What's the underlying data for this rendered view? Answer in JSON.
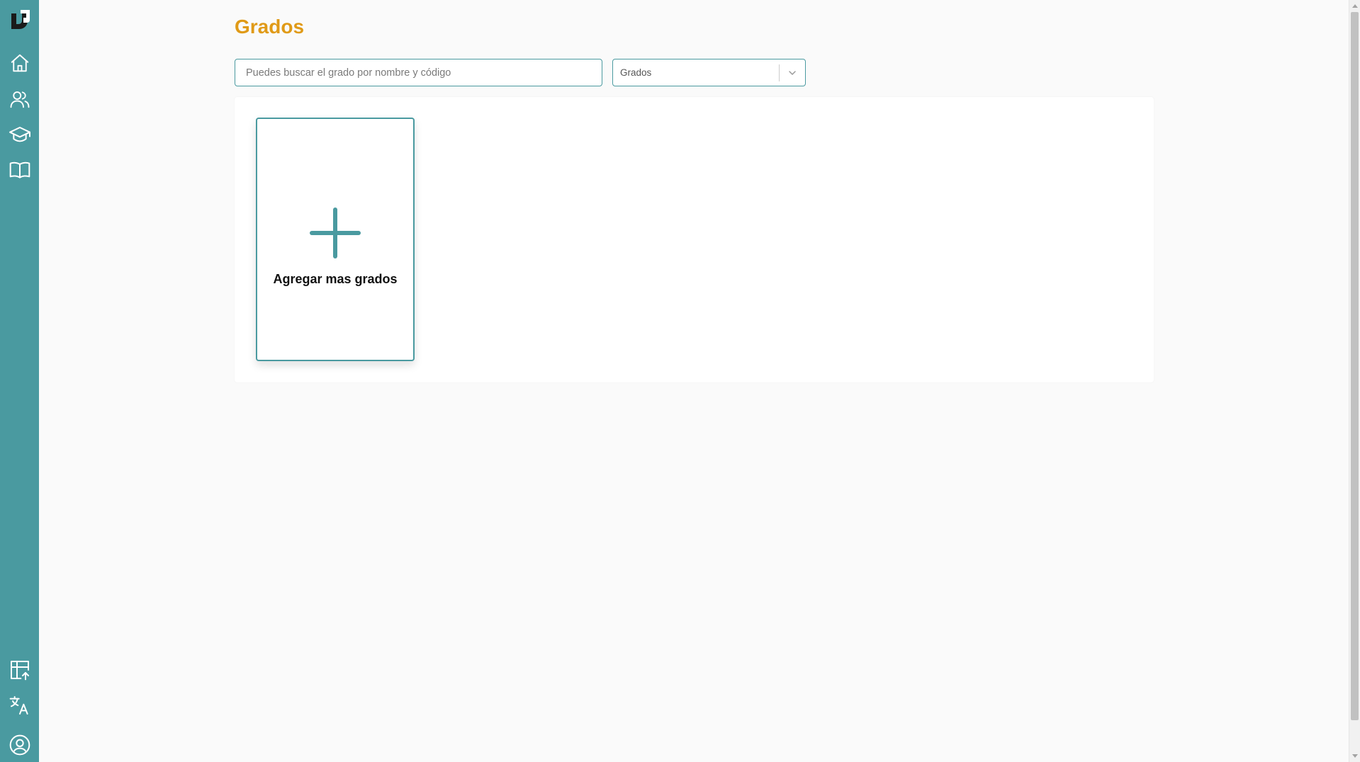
{
  "app": {
    "logo_icon": "d-logo-icon",
    "accent_color": "#4a9aa0",
    "title_color": "#e09a17"
  },
  "sidebar": {
    "top_items": [
      {
        "icon": "home-icon"
      },
      {
        "icon": "users-icon"
      },
      {
        "icon": "graduation-cap-icon"
      },
      {
        "icon": "book-open-icon"
      }
    ],
    "bottom_items": [
      {
        "icon": "table-upload-icon"
      },
      {
        "icon": "translate-icon"
      },
      {
        "icon": "user-circle-icon"
      }
    ]
  },
  "page": {
    "title": "Grados"
  },
  "search": {
    "placeholder": "Puedes buscar el grado por nombre y código",
    "value": ""
  },
  "filter": {
    "selected": "Grados",
    "icon": "chevron-down-icon"
  },
  "add_card": {
    "label": "Agregar mas grados",
    "icon": "plus-icon"
  }
}
